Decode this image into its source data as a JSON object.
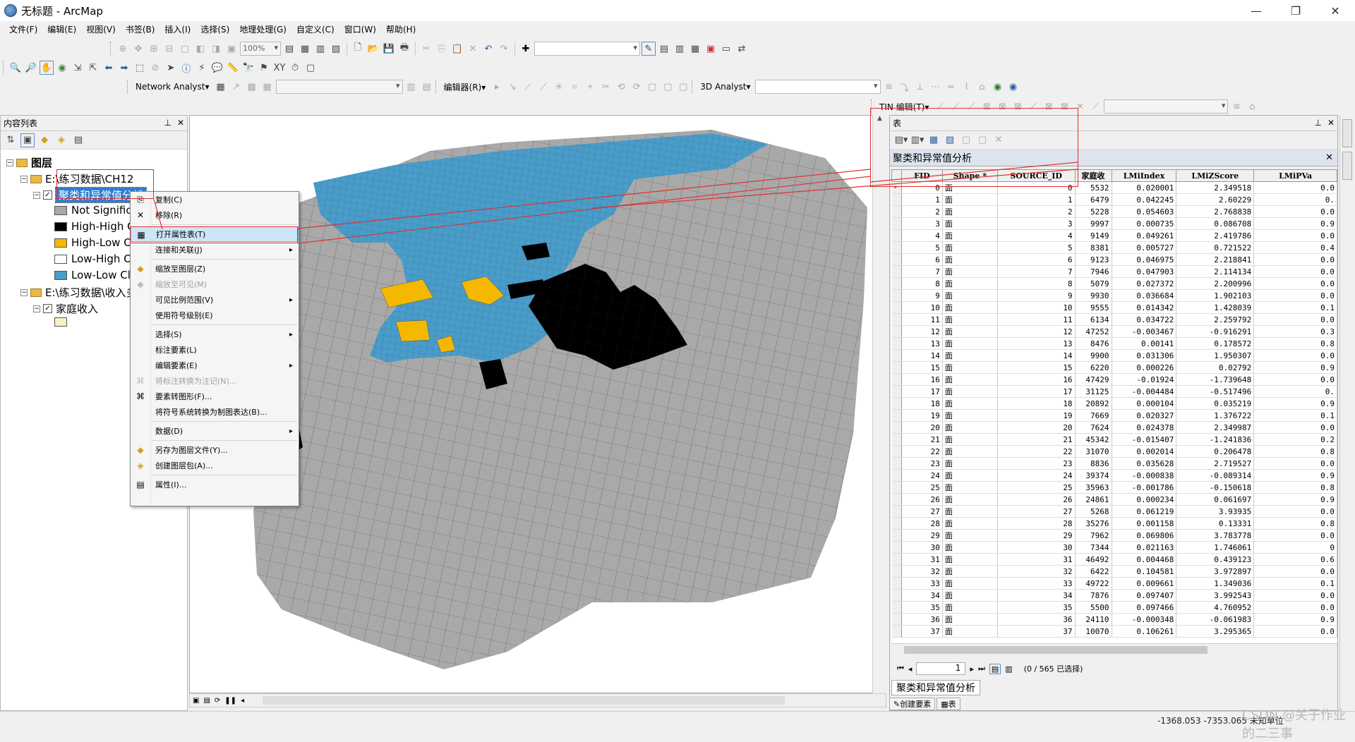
{
  "window": {
    "title": "无标题 - ArcMap",
    "min": "—",
    "max": "❐",
    "close": "✕"
  },
  "menu": [
    "文件(F)",
    "编辑(E)",
    "视图(V)",
    "书签(B)",
    "插入(I)",
    "选择(S)",
    "地理处理(G)",
    "自定义(C)",
    "窗口(W)",
    "帮助(H)"
  ],
  "toolbar": {
    "zoom": "100%",
    "network_analyst": "Network Analyst▾",
    "editor": "编辑器(R)▾",
    "analyst3d": "3D Analyst▾",
    "tin_edit": "TIN 编辑(T)▾"
  },
  "toc": {
    "title": "内容列表",
    "root": "图层",
    "group1": "E:\\练习数据\\CH12",
    "layer1": "聚类和异常值分析",
    "legend": [
      {
        "label": "Not Significa",
        "color": "#a9a9a9"
      },
      {
        "label": "High-High C",
        "color": "#000000"
      },
      {
        "label": "High-Low O",
        "color": "#f5b800"
      },
      {
        "label": "Low-High O",
        "color": "#ffffff"
      },
      {
        "label": "Low-Low Clu",
        "color": "#4a9cc9"
      }
    ],
    "group2": "E:\\练习数据\\收入多",
    "layer2": "家庭收入",
    "layer2_swatch": "#f5f0c8"
  },
  "context_menu": [
    {
      "label": "复制(C)",
      "icon": "copy-icon",
      "state": "normal"
    },
    {
      "label": "移除(R)",
      "icon": "remove-icon",
      "state": "normal"
    },
    {
      "sep": true
    },
    {
      "label": "打开属性表(T)",
      "icon": "table-icon",
      "state": "highlight"
    },
    {
      "label": "连接和关联(J)",
      "state": "submenu"
    },
    {
      "sep": true
    },
    {
      "label": "缩放至图层(Z)",
      "icon": "zoom-layer-icon",
      "state": "normal"
    },
    {
      "label": "缩放至可见(M)",
      "icon": "zoom-visible-icon",
      "state": "disabled"
    },
    {
      "label": "可见比例范围(V)",
      "state": "submenu"
    },
    {
      "label": "使用符号级别(E)",
      "state": "normal"
    },
    {
      "sep": true
    },
    {
      "label": "选择(S)",
      "state": "submenu"
    },
    {
      "label": "标注要素(L)",
      "state": "normal"
    },
    {
      "label": "编辑要素(E)",
      "state": "submenu"
    },
    {
      "label": "将标注转换为注记(N)...",
      "icon": "annotation-icon",
      "state": "disabled"
    },
    {
      "label": "要素转图形(F)...",
      "icon": "graphic-icon",
      "state": "normal"
    },
    {
      "label": "将符号系统转换为制图表达(B)...",
      "state": "normal"
    },
    {
      "sep": true
    },
    {
      "label": "数据(D)",
      "state": "submenu"
    },
    {
      "sep": true
    },
    {
      "label": "另存为图层文件(Y)...",
      "icon": "layer-file-icon",
      "state": "normal"
    },
    {
      "label": "创建图层包(A)...",
      "icon": "layer-package-icon",
      "state": "normal"
    },
    {
      "sep": true
    },
    {
      "label": "属性(I)...",
      "icon": "properties-icon",
      "state": "normal"
    }
  ],
  "table": {
    "panel_title": "表",
    "title": "聚类和异常值分析",
    "columns": [
      "FID",
      "Shape *",
      "SOURCE_ID",
      "家庭收",
      "LMiIndex",
      "LMiZScore",
      "LMiPVa"
    ],
    "rows": [
      [
        "0",
        "面",
        "0",
        "5532",
        "0.020001",
        "2.349518",
        "0.0"
      ],
      [
        "1",
        "面",
        "1",
        "6479",
        "0.042245",
        "2.60229",
        "0."
      ],
      [
        "2",
        "面",
        "2",
        "5228",
        "0.054603",
        "2.768838",
        "0.0"
      ],
      [
        "3",
        "面",
        "3",
        "9997",
        "0.000735",
        "0.086708",
        "0.9"
      ],
      [
        "4",
        "面",
        "4",
        "9149",
        "0.049261",
        "2.419786",
        "0.0"
      ],
      [
        "5",
        "面",
        "5",
        "8381",
        "0.005727",
        "0.721522",
        "0.4"
      ],
      [
        "6",
        "面",
        "6",
        "9123",
        "0.046975",
        "2.218841",
        "0.0"
      ],
      [
        "7",
        "面",
        "7",
        "7946",
        "0.047903",
        "2.114134",
        "0.0"
      ],
      [
        "8",
        "面",
        "8",
        "5079",
        "0.027372",
        "2.200996",
        "0.0"
      ],
      [
        "9",
        "面",
        "9",
        "9930",
        "0.036684",
        "1.902103",
        "0.0"
      ],
      [
        "10",
        "面",
        "10",
        "9555",
        "0.014342",
        "1.428039",
        "0.1"
      ],
      [
        "11",
        "面",
        "11",
        "6134",
        "0.034722",
        "2.259792",
        "0.0"
      ],
      [
        "12",
        "面",
        "12",
        "47252",
        "-0.003467",
        "-0.916291",
        "0.3"
      ],
      [
        "13",
        "面",
        "13",
        "8476",
        "0.00141",
        "0.178572",
        "0.8"
      ],
      [
        "14",
        "面",
        "14",
        "9900",
        "0.031306",
        "1.950307",
        "0.0"
      ],
      [
        "15",
        "面",
        "15",
        "6220",
        "0.000226",
        "0.02792",
        "0.9"
      ],
      [
        "16",
        "面",
        "16",
        "47429",
        "-0.01924",
        "-1.739648",
        "0.0"
      ],
      [
        "17",
        "面",
        "17",
        "31125",
        "-0.004484",
        "-0.517496",
        "0."
      ],
      [
        "18",
        "面",
        "18",
        "20892",
        "0.000104",
        "0.035219",
        "0.9"
      ],
      [
        "19",
        "面",
        "19",
        "7669",
        "0.020327",
        "1.376722",
        "0.1"
      ],
      [
        "20",
        "面",
        "20",
        "7624",
        "0.024378",
        "2.349987",
        "0.0"
      ],
      [
        "21",
        "面",
        "21",
        "45342",
        "-0.015407",
        "-1.241836",
        "0.2"
      ],
      [
        "22",
        "面",
        "22",
        "31070",
        "0.002014",
        "0.206478",
        "0.8"
      ],
      [
        "23",
        "面",
        "23",
        "8836",
        "0.035628",
        "2.719527",
        "0.0"
      ],
      [
        "24",
        "面",
        "24",
        "39374",
        "-0.000838",
        "-0.089314",
        "0.9"
      ],
      [
        "25",
        "面",
        "25",
        "35963",
        "-0.001786",
        "-0.150618",
        "0.8"
      ],
      [
        "26",
        "面",
        "26",
        "24861",
        "0.000234",
        "0.061697",
        "0.9"
      ],
      [
        "27",
        "面",
        "27",
        "5268",
        "0.061219",
        "3.93935",
        "0.0"
      ],
      [
        "28",
        "面",
        "28",
        "35276",
        "0.001158",
        "0.13331",
        "0.8"
      ],
      [
        "29",
        "面",
        "29",
        "7962",
        "0.069806",
        "3.783778",
        "0.0"
      ],
      [
        "30",
        "面",
        "30",
        "7344",
        "0.021163",
        "1.746061",
        "0"
      ],
      [
        "31",
        "面",
        "31",
        "46492",
        "0.004468",
        "0.439123",
        "0.6"
      ],
      [
        "32",
        "面",
        "32",
        "6422",
        "0.104581",
        "3.972897",
        "0.0"
      ],
      [
        "33",
        "面",
        "33",
        "49722",
        "0.009661",
        "1.349036",
        "0.1"
      ],
      [
        "34",
        "面",
        "34",
        "7876",
        "0.097407",
        "3.992543",
        "0.0"
      ],
      [
        "35",
        "面",
        "35",
        "5500",
        "0.097466",
        "4.760952",
        "0.0"
      ],
      [
        "36",
        "面",
        "36",
        "24110",
        "-0.000348",
        "-0.061983",
        "0.9"
      ],
      [
        "37",
        "面",
        "37",
        "10070",
        "0.106261",
        "3.295365",
        "0.0"
      ]
    ],
    "page": "1",
    "selection": "(0 / 565 已选择)",
    "tab": "聚类和异常值分析",
    "bottom_tabs": [
      "创建要素",
      "表"
    ]
  },
  "status": {
    "coords": "-1368.053  -7353.065 未知单位"
  },
  "watermark": "CSDN @关于作业的二三事"
}
